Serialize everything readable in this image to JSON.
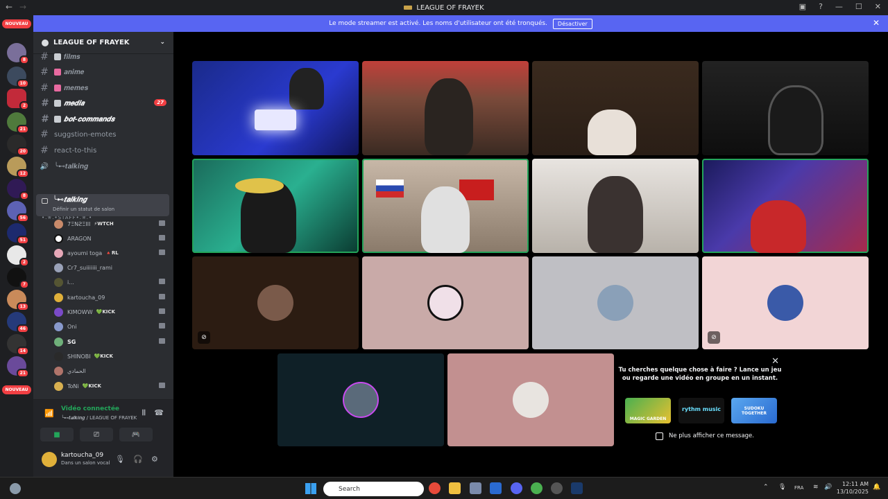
{
  "window": {
    "title": "LEAGUE OF FRAYEK"
  },
  "server_rail": {
    "new_label_top": "NOUVEAU",
    "new_label_bottom": "NOUVEAU",
    "badges": [
      "8",
      "10",
      "3",
      "2",
      "21",
      "20",
      "12",
      "8",
      "56",
      "51",
      "2",
      "7",
      "13",
      "46",
      "14",
      "21"
    ]
  },
  "banner": {
    "text": "Le mode streamer est activé. Les noms d'utilisateur ont été tronqués.",
    "button": "Désactiver"
  },
  "sidebar": {
    "server_name": "LEAGUE OF FRAYEK",
    "channels": [
      {
        "name": "𝒇𝒊𝒍𝒎𝒔",
        "type": "text",
        "unread": false
      },
      {
        "name": "𝒂𝒏𝒊𝒎𝒆",
        "type": "text",
        "unread": false
      },
      {
        "name": "𝒎𝒆𝒎𝒆𝒔",
        "type": "text",
        "unread": false
      },
      {
        "name": "𝒎𝒆𝒅𝒊𝒂",
        "type": "text",
        "unread": true,
        "mentions": "27"
      },
      {
        "name": "𝒃𝒐𝒕-𝒄𝒐𝒎𝒎𝒂𝒏𝒅𝒔",
        "type": "text",
        "unread": true
      },
      {
        "name": "suggstion-emotes",
        "type": "text",
        "unread": false
      },
      {
        "name": "react-to-this",
        "type": "text",
        "unread": false
      },
      {
        "name": "╰⊷𝒕𝒂𝒍𝒌𝒊𝒏𝒈",
        "type": "voice",
        "unread": false
      }
    ],
    "category": "•.✯.•STAFF•.✯.•",
    "active_voice": {
      "name": "╰⊷𝒕𝒂𝒍𝒌𝒊𝒏𝒈",
      "status_hint": "Définir un statut de salon"
    },
    "members": [
      {
        "name": "7ΞΝƧΞΙΙΙ",
        "tag": "⚡WTCH"
      },
      {
        "name": "ARAGON",
        "tag": ""
      },
      {
        "name": "ayoumi toga",
        "tag": "🔺RL"
      },
      {
        "name": "Cr7_suiiiiiii_rami",
        "tag": ""
      },
      {
        "name": "i...",
        "tag": ""
      },
      {
        "name": "kartoucha_09",
        "tag": ""
      },
      {
        "name": "KIMOWW",
        "tag": "💚KICK"
      },
      {
        "name": "Oni",
        "tag": ""
      },
      {
        "name": "SG",
        "tag": ""
      },
      {
        "name": "SHINOBI",
        "tag": "💚KICK"
      },
      {
        "name": "الحمادي",
        "tag": ""
      },
      {
        "name": "ToNi",
        "tag": "💚KICK"
      }
    ]
  },
  "voice_panel": {
    "status": "Vidéo connectée",
    "location": "╰⊷𝒕𝒂𝒍𝒌𝒊𝒏𝒈 / LEAGUE OF FRAYEK"
  },
  "user_panel": {
    "username": "kartoucha_09",
    "status": "Dans un salon vocal"
  },
  "activity": {
    "prompt": "Tu cherches quelque chose à faire ? Lance un jeu ou regarde une vidéo en groupe en un instant.",
    "games": [
      "MAGIC GARDEN",
      "rythm music",
      "SUDOKU TOGETHER"
    ],
    "dont_show": "Ne plus afficher ce message."
  },
  "taskbar": {
    "search_placeholder": "Search",
    "lang": "FRA",
    "time": "12:11 AM",
    "date": "13/10/2025"
  },
  "colors": {
    "accent": "#5865f2",
    "speaking": "#23a55a",
    "danger": "#f23f43"
  }
}
